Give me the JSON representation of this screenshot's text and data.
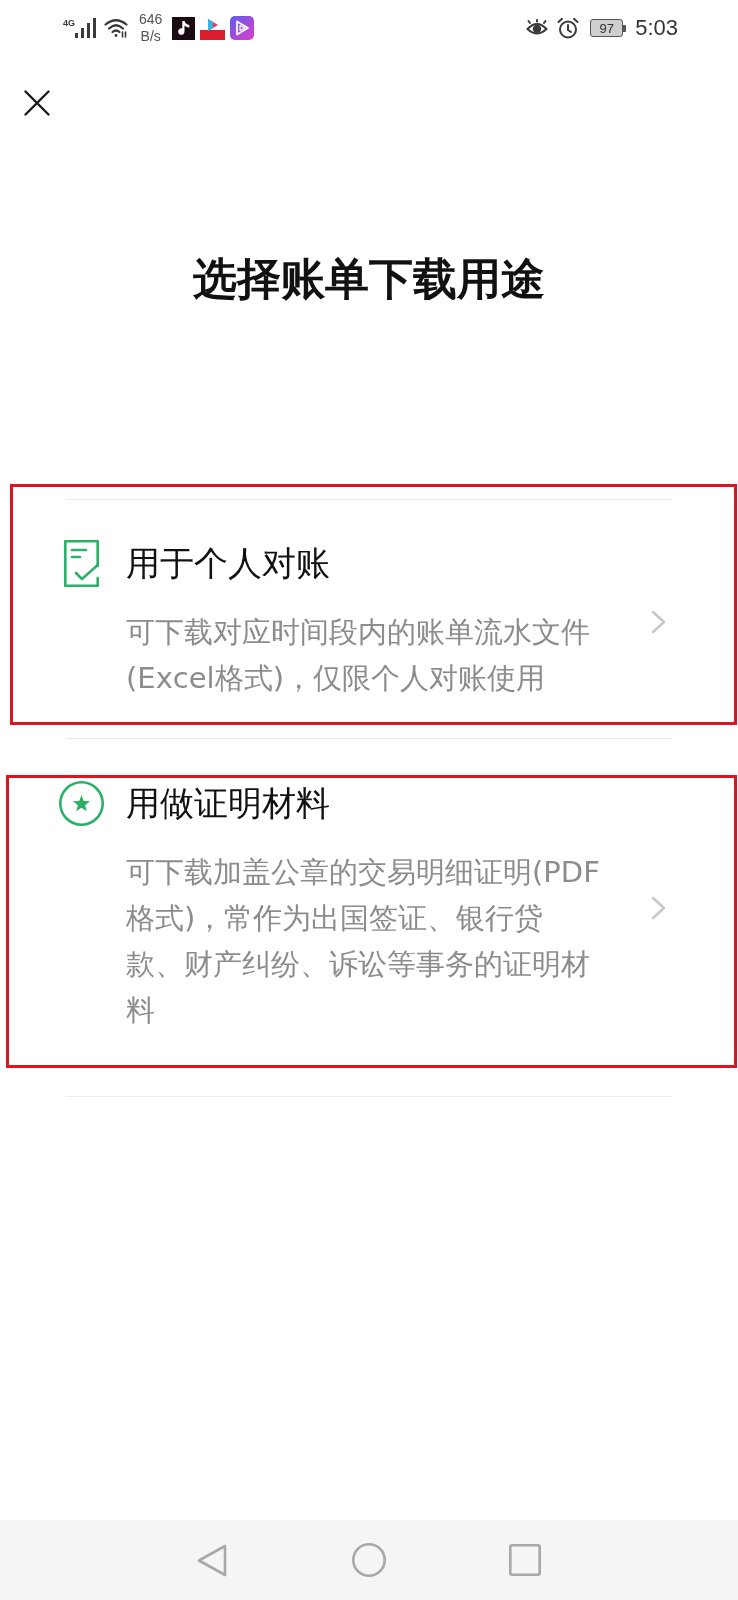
{
  "status_bar": {
    "network": "4G",
    "speed_value": "646",
    "speed_unit": "B/s",
    "battery": "97",
    "time": "5:03"
  },
  "title": "选择账单下载用途",
  "options": [
    {
      "title": "用于个人对账",
      "description": "可下载对应时间段内的账单流水文件(Excel格式)，仅限个人对账使用",
      "highlighted": true
    },
    {
      "title": "用做证明材料",
      "description": "可下载加盖公章的交易明细证明(PDF格式)，常作为出国签证、银行贷款、财产纠纷、诉讼等事务的证明材料",
      "highlighted": true
    }
  ]
}
